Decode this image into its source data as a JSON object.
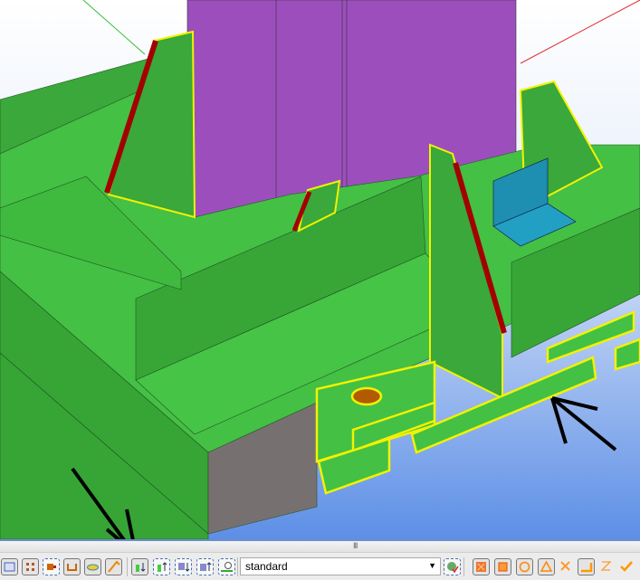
{
  "splitter": {
    "grip": "III"
  },
  "toolbar": {
    "left_icons": [
      "view-frame-icon",
      "grid-icon",
      "part-icon",
      "select-component-icon",
      "surface-icon",
      "pointer-assembly-icon"
    ],
    "select_icons": [
      "select-assembly-down-icon",
      "select-assembly-up-icon",
      "select-object-down-icon",
      "select-object-up-icon",
      "select-time-icon"
    ],
    "filter_combo": {
      "value": "standard"
    },
    "snap_icons": [
      "snap-settings-icon",
      "snap-reference-icon",
      "snap-geometry-icon",
      "snap-circle-icon",
      "snap-triangle-icon",
      "snap-cross-icon",
      "snap-line-icon",
      "snap-perpendicular-icon",
      "snap-check-icon"
    ]
  },
  "colors": {
    "steel": "#3fbf3f",
    "selected": "#f2f200",
    "column": "#9c4fbc",
    "cut": "#a30000",
    "angle": "#1e95b5",
    "concrete": "#777070"
  }
}
